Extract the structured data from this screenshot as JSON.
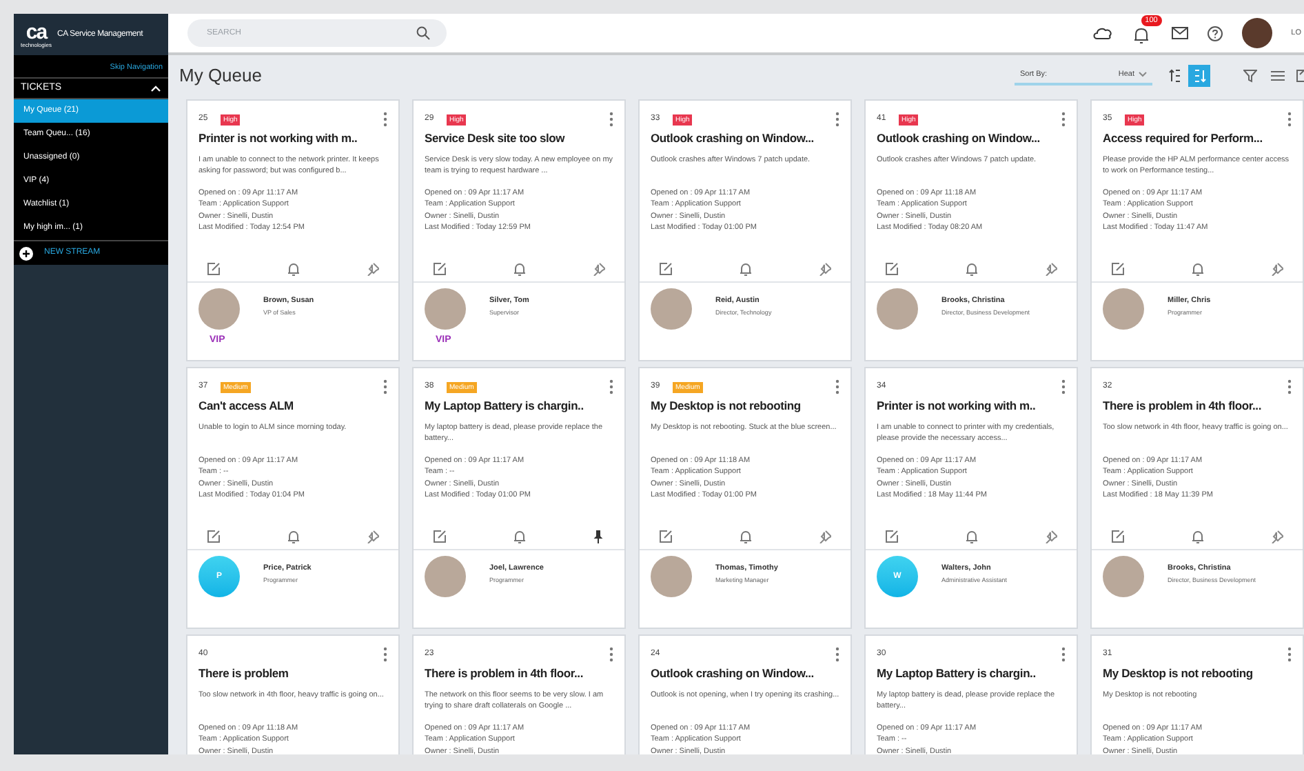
{
  "brand": {
    "logo": "ca",
    "logo_sub": "technologies",
    "product": "CA Service Management"
  },
  "search": {
    "placeholder": "SEARCH"
  },
  "header": {
    "notification_count": "100",
    "user_label": "LO"
  },
  "sidebar": {
    "skip_link": "Skip Navigation",
    "section": {
      "label": "TICKETS",
      "expanded": true
    },
    "items": [
      {
        "label": "My Queue (21)",
        "selected": true
      },
      {
        "label": "Team Queu... (16)",
        "selected": false
      },
      {
        "label": "Unassigned (0)",
        "selected": false
      },
      {
        "label": "VIP (4)",
        "selected": false
      },
      {
        "label": "Watchlist (1)",
        "selected": false
      },
      {
        "label": "My high im... (1)",
        "selected": false
      }
    ],
    "new_stream": "NEW STREAM"
  },
  "page_title": "My Queue",
  "sort": {
    "label": "Sort By:",
    "value": "Heat",
    "descending": true
  },
  "cards": [
    {
      "id": "25",
      "priority": {
        "kind": "high",
        "label": "High"
      },
      "title": "Printer is not working with m..",
      "description": "I am unable to connect to the network printer. It keeps asking for password; but was configured b...",
      "opened": "Opened on : 09 Apr 11:17 AM",
      "team": "Team : Application Support",
      "owner": "Owner : Sinelli, Dustin",
      "modified": "Last Modified : Today 12:54 PM",
      "pinned": false,
      "contact": {
        "name": "Brown, Susan",
        "role": "VP of Sales",
        "kind": "photo",
        "vip": "VIP"
      }
    },
    {
      "id": "29",
      "priority": {
        "kind": "high",
        "label": "High"
      },
      "title": "Service Desk site too slow",
      "description": "Service Desk is very slow today. A new employee on my team is trying to request hardware ...",
      "opened": "Opened on : 09 Apr 11:17 AM",
      "team": "Team : Application Support",
      "owner": "Owner : Sinelli, Dustin",
      "modified": "Last Modified : Today 12:59 PM",
      "pinned": false,
      "contact": {
        "name": "Silver, Tom",
        "role": "Supervisor",
        "kind": "photo",
        "vip": "VIP"
      }
    },
    {
      "id": "33",
      "priority": {
        "kind": "high",
        "label": "High"
      },
      "title": "Outlook crashing on Window...",
      "description": "Outlook crashes after Windows 7 patch update.",
      "opened": "Opened on : 09 Apr 11:17 AM",
      "team": "Team : Application Support",
      "owner": "Owner : Sinelli, Dustin",
      "modified": "Last Modified : Today 01:00 PM",
      "pinned": false,
      "contact": {
        "name": "Reid, Austin",
        "role": "Director, Technology",
        "kind": "photo"
      }
    },
    {
      "id": "41",
      "priority": {
        "kind": "high",
        "label": "High"
      },
      "title": "Outlook crashing on Window...",
      "description": "Outlook crashes after Windows 7 patch update.",
      "opened": "Opened on : 09 Apr 11:18 AM",
      "team": "Team : Application Support",
      "owner": "Owner : Sinelli, Dustin",
      "modified": "Last Modified : Today 08:20 AM",
      "pinned": false,
      "contact": {
        "name": "Brooks, Christina",
        "role": "Director, Business Development",
        "kind": "photo"
      }
    },
    {
      "id": "35",
      "priority": {
        "kind": "high",
        "label": "High"
      },
      "title": "Access required for Perform...",
      "description": "Please provide the HP ALM performance center access to work on Performance testing...",
      "opened": "Opened on : 09 Apr 11:17 AM",
      "team": "Team : Application Support",
      "owner": "Owner : Sinelli, Dustin",
      "modified": "Last Modified : Today 11:47 AM",
      "pinned": false,
      "contact": {
        "name": "Miller, Chris",
        "role": "Programmer",
        "kind": "photo"
      }
    },
    {
      "id": "37",
      "priority": {
        "kind": "medium",
        "label": "Medium"
      },
      "title": "Can't access ALM",
      "description": "Unable to login to ALM since morning today.",
      "opened": "Opened on : 09 Apr 11:17 AM",
      "team": "Team : --",
      "owner": "Owner : Sinelli, Dustin",
      "modified": "Last Modified : Today 01:04 PM",
      "pinned": false,
      "contact": {
        "name": "Price, Patrick",
        "role": "Programmer",
        "kind": "initial",
        "initial": "P"
      }
    },
    {
      "id": "38",
      "priority": {
        "kind": "medium",
        "label": "Medium"
      },
      "title": "My Laptop Battery is chargin..",
      "description": "My laptop battery is dead, please provide replace the battery...",
      "opened": "Opened on : 09 Apr 11:17 AM",
      "team": "Team : --",
      "owner": "Owner : Sinelli, Dustin",
      "modified": "Last Modified : Today 01:00 PM",
      "pinned": true,
      "contact": {
        "name": "Joel, Lawrence",
        "role": "Programmer",
        "kind": "photo"
      }
    },
    {
      "id": "39",
      "priority": {
        "kind": "medium",
        "label": "Medium"
      },
      "title": "My Desktop is not rebooting",
      "description": "My Desktop is not rebooting. Stuck at the blue screen...",
      "opened": "Opened on : 09 Apr 11:18 AM",
      "team": "Team : Application Support",
      "owner": "Owner : Sinelli, Dustin",
      "modified": "Last Modified : Today 01:00 PM",
      "pinned": false,
      "contact": {
        "name": "Thomas, Timothy",
        "role": "Marketing Manager",
        "kind": "photo"
      }
    },
    {
      "id": "34",
      "priority": {
        "kind": "none"
      },
      "title": "Printer is not working with m..",
      "description": "I am unable to connect to printer with my credentials, please provide the necessary access...",
      "opened": "Opened on : 09 Apr 11:17 AM",
      "team": "Team : Application Support",
      "owner": "Owner : Sinelli, Dustin",
      "modified": "Last Modified : 18 May 11:44 PM",
      "pinned": false,
      "contact": {
        "name": "Walters, John",
        "role": "Administrative Assistant",
        "kind": "initial",
        "initial": "W"
      }
    },
    {
      "id": "32",
      "priority": {
        "kind": "none"
      },
      "title": "There is problem in 4th floor...",
      "description": "Too slow network in 4th floor, heavy traffic is going on...",
      "opened": "Opened on : 09 Apr 11:17 AM",
      "team": "Team : Application Support",
      "owner": "Owner : Sinelli, Dustin",
      "modified": "Last Modified : 18 May 11:39 PM",
      "pinned": false,
      "contact": {
        "name": "Brooks, Christina",
        "role": "Director, Business Development",
        "kind": "photo"
      }
    },
    {
      "id": "40",
      "priority": {
        "kind": "none"
      },
      "title": "There is problem",
      "description": "Too slow network in 4th floor, heavy traffic is going on...",
      "opened": "Opened on : 09 Apr 11:18 AM",
      "team": "Team : Application Support",
      "owner": "Owner : Sinelli, Dustin"
    },
    {
      "id": "23",
      "priority": {
        "kind": "none"
      },
      "title": "There is problem in 4th floor...",
      "description": "The network on this floor seems to be very slow. I am trying to share draft collaterals on Google ...",
      "opened": "Opened on : 09 Apr 11:17 AM",
      "team": "Team : Application Support",
      "owner": "Owner : Sinelli, Dustin"
    },
    {
      "id": "24",
      "priority": {
        "kind": "none"
      },
      "title": "Outlook crashing on Window...",
      "description": "Outlook is not opening, when I try opening its crashing...",
      "opened": "Opened on : 09 Apr 11:17 AM",
      "team": "Team : Application Support",
      "owner": "Owner : Sinelli, Dustin"
    },
    {
      "id": "30",
      "priority": {
        "kind": "none"
      },
      "title": "My Laptop Battery is chargin..",
      "description": "My laptop battery is dead, please provide replace the battery...",
      "opened": "Opened on : 09 Apr 11:17 AM",
      "team": "Team : --",
      "owner": "Owner : Sinelli, Dustin"
    },
    {
      "id": "31",
      "priority": {
        "kind": "none"
      },
      "title": "My Desktop is not rebooting",
      "description": "My Desktop is not rebooting",
      "opened": "Opened on : 09 Apr 11:17 AM",
      "team": "Team : Application Support",
      "owner": "Owner : Sinelli, Dustin"
    }
  ]
}
